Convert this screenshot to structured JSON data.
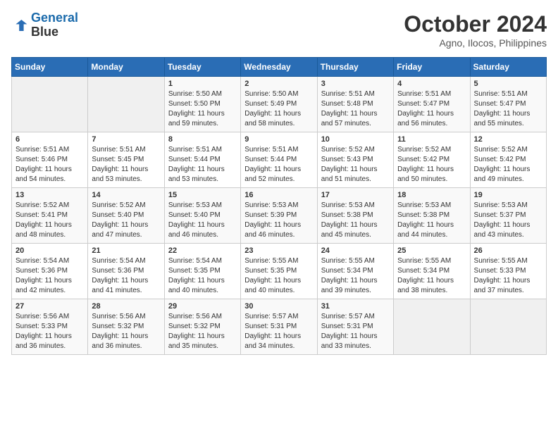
{
  "header": {
    "logo_line1": "General",
    "logo_line2": "Blue",
    "month": "October 2024",
    "location": "Agno, Ilocos, Philippines"
  },
  "days_of_week": [
    "Sunday",
    "Monday",
    "Tuesday",
    "Wednesday",
    "Thursday",
    "Friday",
    "Saturday"
  ],
  "weeks": [
    [
      {
        "day": "",
        "sunrise": "",
        "sunset": "",
        "daylight": ""
      },
      {
        "day": "",
        "sunrise": "",
        "sunset": "",
        "daylight": ""
      },
      {
        "day": "1",
        "sunrise": "Sunrise: 5:50 AM",
        "sunset": "Sunset: 5:50 PM",
        "daylight": "Daylight: 11 hours and 59 minutes."
      },
      {
        "day": "2",
        "sunrise": "Sunrise: 5:50 AM",
        "sunset": "Sunset: 5:49 PM",
        "daylight": "Daylight: 11 hours and 58 minutes."
      },
      {
        "day": "3",
        "sunrise": "Sunrise: 5:51 AM",
        "sunset": "Sunset: 5:48 PM",
        "daylight": "Daylight: 11 hours and 57 minutes."
      },
      {
        "day": "4",
        "sunrise": "Sunrise: 5:51 AM",
        "sunset": "Sunset: 5:47 PM",
        "daylight": "Daylight: 11 hours and 56 minutes."
      },
      {
        "day": "5",
        "sunrise": "Sunrise: 5:51 AM",
        "sunset": "Sunset: 5:47 PM",
        "daylight": "Daylight: 11 hours and 55 minutes."
      }
    ],
    [
      {
        "day": "6",
        "sunrise": "Sunrise: 5:51 AM",
        "sunset": "Sunset: 5:46 PM",
        "daylight": "Daylight: 11 hours and 54 minutes."
      },
      {
        "day": "7",
        "sunrise": "Sunrise: 5:51 AM",
        "sunset": "Sunset: 5:45 PM",
        "daylight": "Daylight: 11 hours and 53 minutes."
      },
      {
        "day": "8",
        "sunrise": "Sunrise: 5:51 AM",
        "sunset": "Sunset: 5:44 PM",
        "daylight": "Daylight: 11 hours and 53 minutes."
      },
      {
        "day": "9",
        "sunrise": "Sunrise: 5:51 AM",
        "sunset": "Sunset: 5:44 PM",
        "daylight": "Daylight: 11 hours and 52 minutes."
      },
      {
        "day": "10",
        "sunrise": "Sunrise: 5:52 AM",
        "sunset": "Sunset: 5:43 PM",
        "daylight": "Daylight: 11 hours and 51 minutes."
      },
      {
        "day": "11",
        "sunrise": "Sunrise: 5:52 AM",
        "sunset": "Sunset: 5:42 PM",
        "daylight": "Daylight: 11 hours and 50 minutes."
      },
      {
        "day": "12",
        "sunrise": "Sunrise: 5:52 AM",
        "sunset": "Sunset: 5:42 PM",
        "daylight": "Daylight: 11 hours and 49 minutes."
      }
    ],
    [
      {
        "day": "13",
        "sunrise": "Sunrise: 5:52 AM",
        "sunset": "Sunset: 5:41 PM",
        "daylight": "Daylight: 11 hours and 48 minutes."
      },
      {
        "day": "14",
        "sunrise": "Sunrise: 5:52 AM",
        "sunset": "Sunset: 5:40 PM",
        "daylight": "Daylight: 11 hours and 47 minutes."
      },
      {
        "day": "15",
        "sunrise": "Sunrise: 5:53 AM",
        "sunset": "Sunset: 5:40 PM",
        "daylight": "Daylight: 11 hours and 46 minutes."
      },
      {
        "day": "16",
        "sunrise": "Sunrise: 5:53 AM",
        "sunset": "Sunset: 5:39 PM",
        "daylight": "Daylight: 11 hours and 46 minutes."
      },
      {
        "day": "17",
        "sunrise": "Sunrise: 5:53 AM",
        "sunset": "Sunset: 5:38 PM",
        "daylight": "Daylight: 11 hours and 45 minutes."
      },
      {
        "day": "18",
        "sunrise": "Sunrise: 5:53 AM",
        "sunset": "Sunset: 5:38 PM",
        "daylight": "Daylight: 11 hours and 44 minutes."
      },
      {
        "day": "19",
        "sunrise": "Sunrise: 5:53 AM",
        "sunset": "Sunset: 5:37 PM",
        "daylight": "Daylight: 11 hours and 43 minutes."
      }
    ],
    [
      {
        "day": "20",
        "sunrise": "Sunrise: 5:54 AM",
        "sunset": "Sunset: 5:36 PM",
        "daylight": "Daylight: 11 hours and 42 minutes."
      },
      {
        "day": "21",
        "sunrise": "Sunrise: 5:54 AM",
        "sunset": "Sunset: 5:36 PM",
        "daylight": "Daylight: 11 hours and 41 minutes."
      },
      {
        "day": "22",
        "sunrise": "Sunrise: 5:54 AM",
        "sunset": "Sunset: 5:35 PM",
        "daylight": "Daylight: 11 hours and 40 minutes."
      },
      {
        "day": "23",
        "sunrise": "Sunrise: 5:55 AM",
        "sunset": "Sunset: 5:35 PM",
        "daylight": "Daylight: 11 hours and 40 minutes."
      },
      {
        "day": "24",
        "sunrise": "Sunrise: 5:55 AM",
        "sunset": "Sunset: 5:34 PM",
        "daylight": "Daylight: 11 hours and 39 minutes."
      },
      {
        "day": "25",
        "sunrise": "Sunrise: 5:55 AM",
        "sunset": "Sunset: 5:34 PM",
        "daylight": "Daylight: 11 hours and 38 minutes."
      },
      {
        "day": "26",
        "sunrise": "Sunrise: 5:55 AM",
        "sunset": "Sunset: 5:33 PM",
        "daylight": "Daylight: 11 hours and 37 minutes."
      }
    ],
    [
      {
        "day": "27",
        "sunrise": "Sunrise: 5:56 AM",
        "sunset": "Sunset: 5:33 PM",
        "daylight": "Daylight: 11 hours and 36 minutes."
      },
      {
        "day": "28",
        "sunrise": "Sunrise: 5:56 AM",
        "sunset": "Sunset: 5:32 PM",
        "daylight": "Daylight: 11 hours and 36 minutes."
      },
      {
        "day": "29",
        "sunrise": "Sunrise: 5:56 AM",
        "sunset": "Sunset: 5:32 PM",
        "daylight": "Daylight: 11 hours and 35 minutes."
      },
      {
        "day": "30",
        "sunrise": "Sunrise: 5:57 AM",
        "sunset": "Sunset: 5:31 PM",
        "daylight": "Daylight: 11 hours and 34 minutes."
      },
      {
        "day": "31",
        "sunrise": "Sunrise: 5:57 AM",
        "sunset": "Sunset: 5:31 PM",
        "daylight": "Daylight: 11 hours and 33 minutes."
      },
      {
        "day": "",
        "sunrise": "",
        "sunset": "",
        "daylight": ""
      },
      {
        "day": "",
        "sunrise": "",
        "sunset": "",
        "daylight": ""
      }
    ]
  ]
}
